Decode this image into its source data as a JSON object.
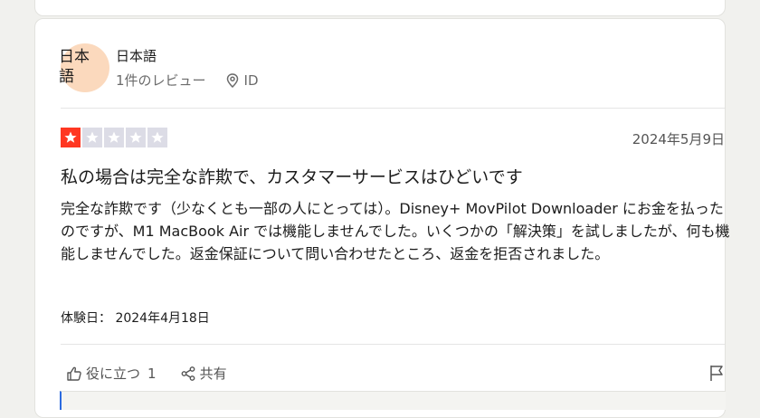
{
  "reviewer": {
    "avatar_text": "日本語",
    "name": "日本語",
    "review_count": "1件のレビュー",
    "location": "ID",
    "avatar_color": "#fbd9bd"
  },
  "review": {
    "rating": 1,
    "max_rating": 5,
    "star_color": "#ff3722",
    "date": "2024年5月9日",
    "title": "私の場合は完全な詐欺で、カスタマーサービスはひどいです",
    "body": "完全な詐欺です（少なくとも一部の人にとっては）。Disney+ MovPilot Downloader にお金を払ったのですが、M1 MacBook Air では機能しませんでした。いくつかの「解決策」を試しましたが、何も機能しませんでした。返金保証について問い合わせたところ、返金を拒否されました。",
    "experience_label": "体験日：",
    "experience_date": "2024年4月18日"
  },
  "actions": {
    "helpful_label": "役に立つ",
    "helpful_count": "1",
    "share_label": "共有"
  },
  "icons": [
    "pin-icon",
    "star-icon",
    "thumbs-up-icon",
    "share-icon",
    "flag-icon"
  ]
}
